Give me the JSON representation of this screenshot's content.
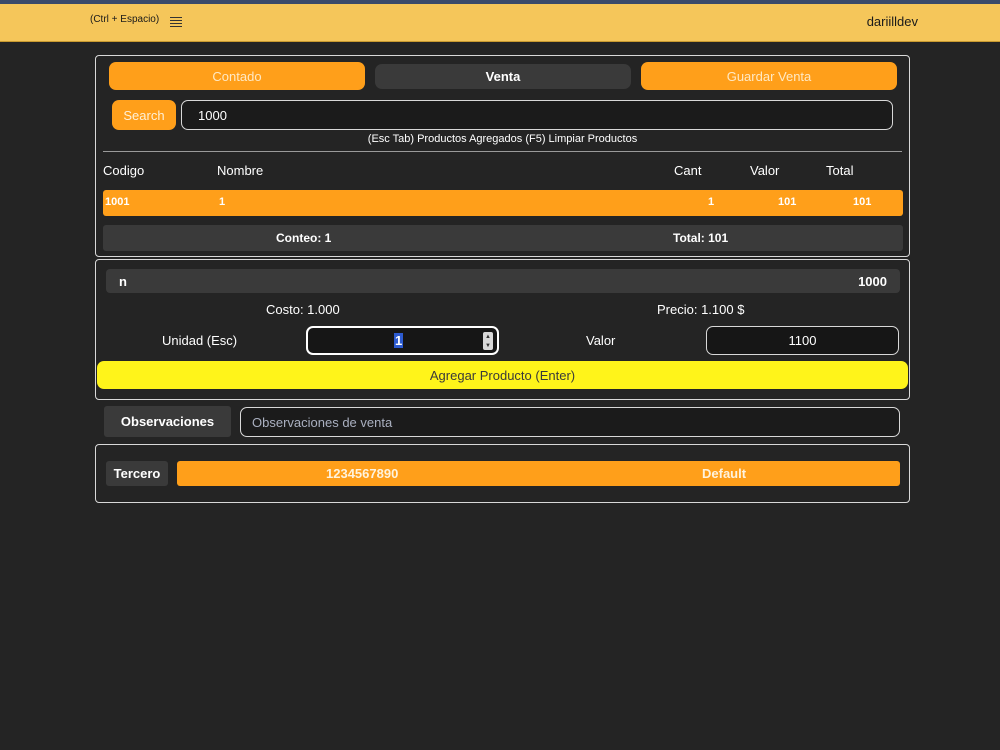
{
  "topbar": {
    "shortcut": "(Ctrl + Espacio)",
    "menu_icon": "hamburger-icon",
    "user": "dariilldev"
  },
  "actions": {
    "contado": "Contado",
    "venta": "Venta",
    "guardar": "Guardar Venta"
  },
  "search": {
    "button": "Search",
    "value": "1000"
  },
  "hint": "(Esc Tab) Productos Agregados (F5) Limpiar Productos",
  "table": {
    "headers": {
      "codigo": "Codigo",
      "nombre": "Nombre",
      "cant": "Cant",
      "valor": "Valor",
      "total": "Total"
    },
    "rows": [
      {
        "codigo": "1001",
        "nombre": "1",
        "cant": "1",
        "valor": "101",
        "total": "101"
      }
    ],
    "conteo": "Conteo: 1",
    "total": "Total: 101"
  },
  "product": {
    "name": "n",
    "code": "1000",
    "costo": "Costo: 1.000",
    "precio": "Precio: 1.100 $",
    "unidad_label": "Unidad (Esc)",
    "unidad_value": "1",
    "valor_label": "Valor",
    "valor_value": "1100",
    "add_button": "Agregar Producto (Enter)"
  },
  "observaciones": {
    "label": "Observaciones",
    "placeholder": "Observaciones de venta"
  },
  "tercero": {
    "label": "Tercero",
    "id": "1234567890",
    "name": "Default"
  },
  "colors": {
    "topbar": "#f5c65a",
    "accent": "#ff9f1a",
    "add": "#fff41a",
    "background": "#242424"
  }
}
